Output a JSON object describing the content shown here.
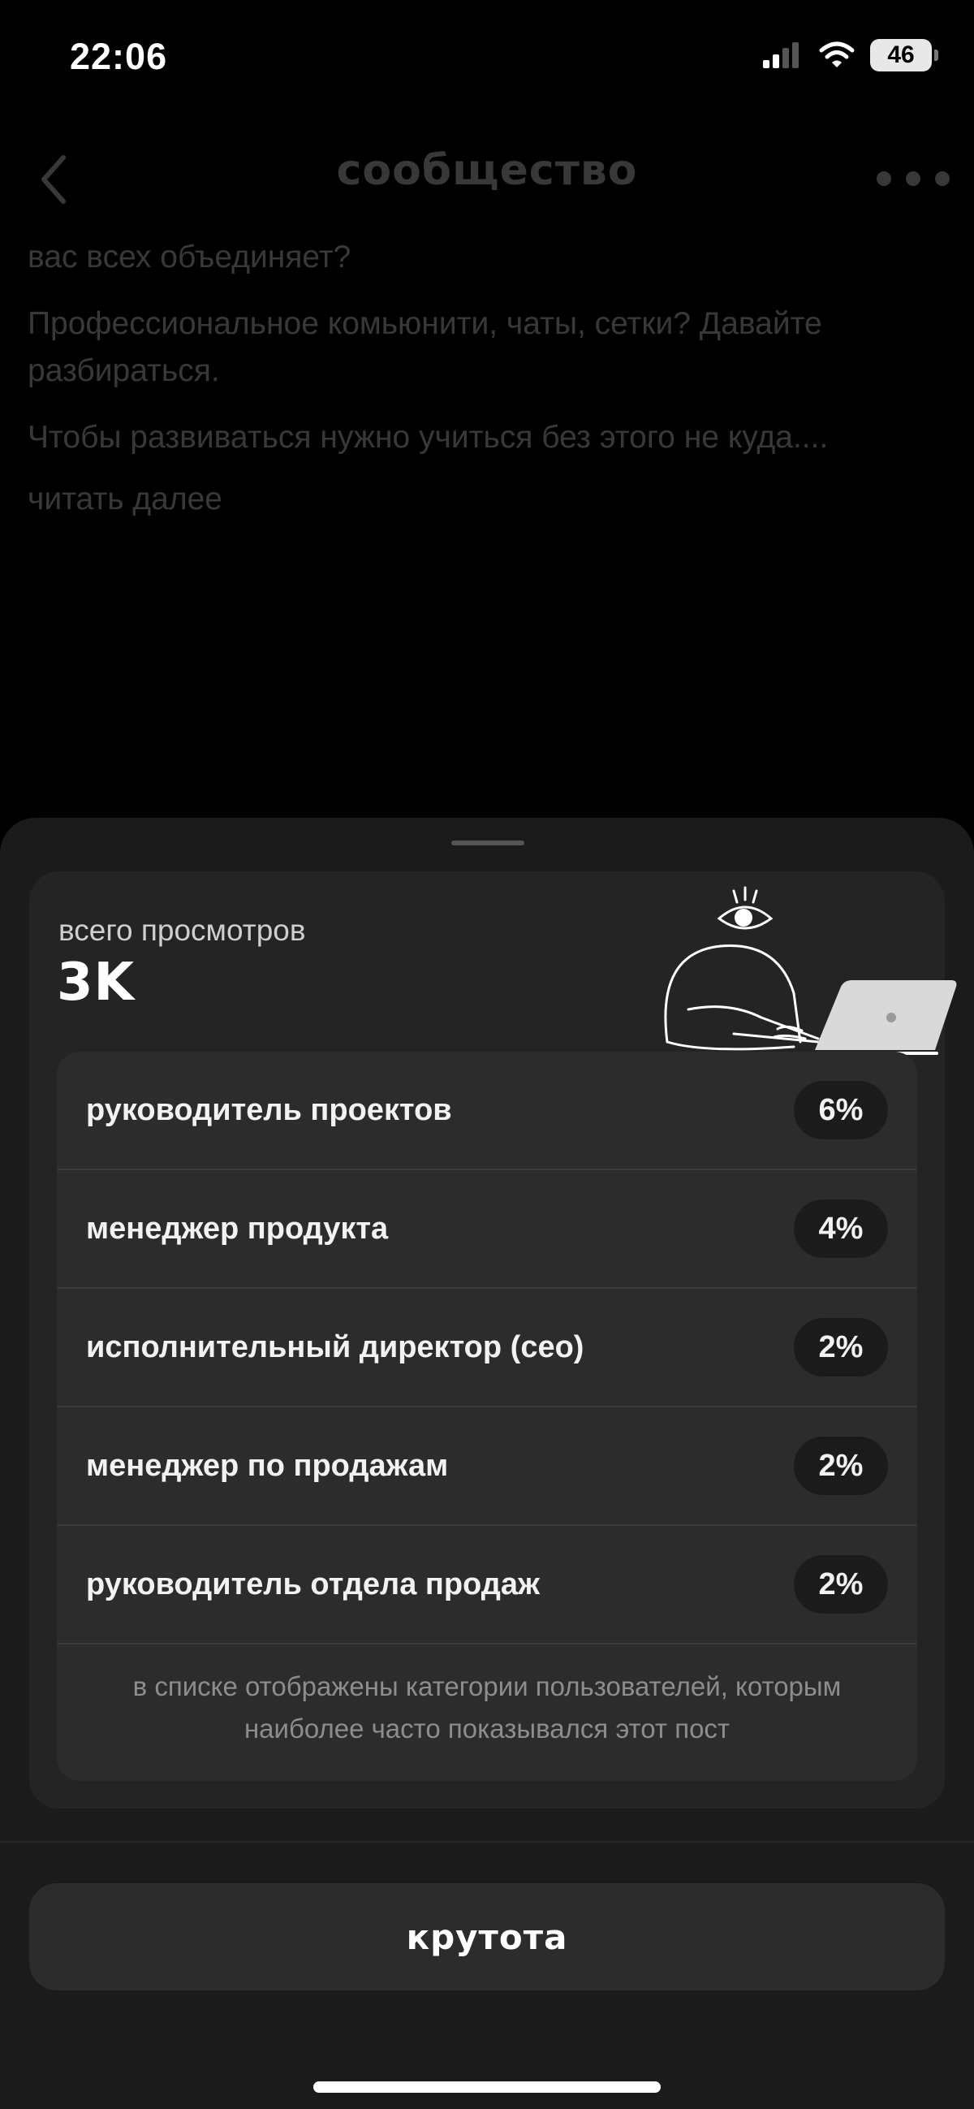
{
  "status_bar": {
    "time": "22:06",
    "battery": "46"
  },
  "background_page": {
    "title": "сообщество",
    "paragraphs": [
      "вас всех объединяет?",
      "Профессиональное комьюнити, чаты, сетки? Давайте разбираться.",
      "Чтобы развиваться нужно учиться без этого не куда...."
    ],
    "read_more": "читать далее"
  },
  "sheet": {
    "views_label": "всего просмотров",
    "views_value": "3K",
    "categories": [
      {
        "label": "руководитель проектов",
        "percent": "6%"
      },
      {
        "label": "менеджер продукта",
        "percent": "4%"
      },
      {
        "label": "исполнительный директор (ceo)",
        "percent": "2%"
      },
      {
        "label": "менеджер по продажам",
        "percent": "2%"
      },
      {
        "label": "руководитель отдела продаж",
        "percent": "2%"
      }
    ],
    "note": "в списке отображены категории пользователей, которым наиболее часто показывался этот пост",
    "button_label": "крутота"
  },
  "icons": {
    "back": "chevron-left-icon",
    "more": "more-dots-icon",
    "signal": "signal-icon",
    "wifi": "wifi-icon",
    "battery": "battery-icon",
    "illustration": "person-with-laptop-illustration"
  },
  "colors": {
    "background": "#000000",
    "sheet": "#1b1b1b",
    "card": "#242424",
    "list": "#2c2c2c",
    "muted_text": "#8d8d8d"
  }
}
